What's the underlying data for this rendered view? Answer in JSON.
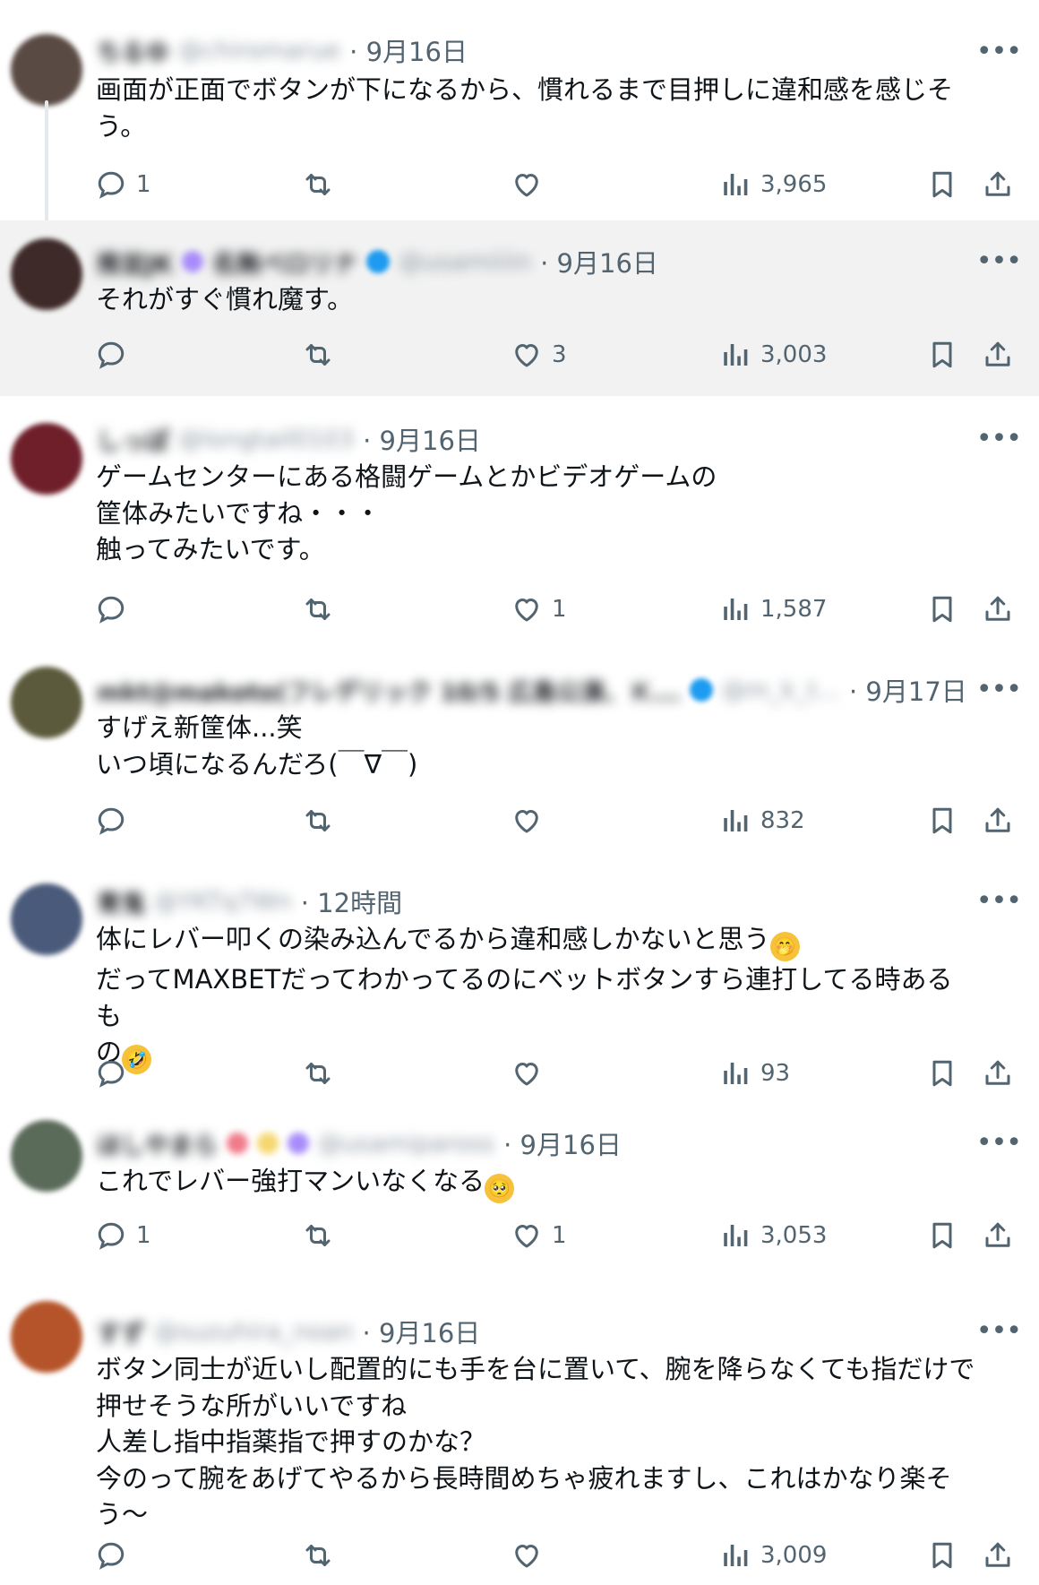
{
  "menu_glyph": "•••",
  "tweets": [
    {
      "id": "t1",
      "avatar_color": "#5a4a44",
      "name_blurred": "ちるゆ",
      "handle_blurred": "@chiromarue",
      "decor": [],
      "date_label": "· 9月16日",
      "text": "画面が正面でボタンが下になるから、慣れるまで目押しに違和感を感じそ\nう。",
      "emoji": null,
      "reply_count": "1",
      "like_count": "",
      "view_count": "3,965"
    },
    {
      "id": "t2",
      "avatar_color": "#3e2a28",
      "name_blurred": "推並JK",
      "handle_blurred": "@usamiiiin",
      "decor": [
        "#a78bfa",
        "名無べロリナ",
        "#1d9bf0"
      ],
      "date_label": "· 9月16日",
      "text": "それがすぐ慣れ魔す。",
      "emoji": null,
      "reply_count": "",
      "like_count": "3",
      "view_count": "3,003"
    },
    {
      "id": "t3",
      "avatar_color": "#6e1f2a",
      "name_blurred": "しっぽ",
      "handle_blurred": "@longtail0103",
      "decor": [],
      "date_label": "· 9月16日",
      "text": "ゲームセンターにある格闘ゲームとかビデオゲームの\n筐体みたいですね・・・\n触ってみたいです。",
      "emoji": null,
      "reply_count": "",
      "like_count": "1",
      "view_count": "1,587"
    },
    {
      "id": "t4",
      "avatar_color": "#5c5a3c",
      "name_blurred": "mkt@makoto(フレデリック 10/5 広島公演、Ｋ...",
      "handle_blurred": "@m_k_t...",
      "decor": [],
      "date_label": "· 9月17日",
      "text": "すげえ新筐体...笑\nいつ頃になるんだろ(￣∇￣)",
      "emoji": null,
      "reply_count": "",
      "like_count": "",
      "view_count": "832"
    },
    {
      "id": "t5",
      "avatar_color": "#4a5a7a",
      "name_blurred": "青鬼",
      "handle_blurred": "@YKTq7Wn",
      "decor": [],
      "date_label": "· 12時間",
      "text": "体にレバー叩くの染み込んでるから違和感しかないと思う",
      "text_emoji": "🤭",
      "text2": "\nだってMAXBETだってわかってるのにベットボタンすら連打してる時あるも\nの",
      "emoji": "🤣",
      "reply_count": "",
      "like_count": "",
      "view_count": "93"
    },
    {
      "id": "t6",
      "avatar_color": "#5b6b5a",
      "name_blurred": "ほしやまら",
      "handle_blurred": "@usamipaross",
      "decor": [
        "#f07a8a",
        "#f5d76e",
        "#a78bfa"
      ],
      "date_label": "· 9月16日",
      "text": "これでレバー強打マンいなくなる",
      "emoji": "🥺",
      "reply_count": "1",
      "like_count": "1",
      "view_count": "3,053"
    },
    {
      "id": "t7",
      "avatar_color": "#b5542a",
      "name_blurred": "すず",
      "handle_blurred": "@suzuhira_noan",
      "decor": [],
      "date_label": "· 9月16日",
      "text": "ボタン同士が近いし配置的にも手を台に置いて、腕を降らなくても指だけで\n押せそうな所がいいですね\n人差し指中指薬指で押すのかな？\n今のって腕をあげてやるから長時間めちゃ疲れますし、これはかなり楽そ\nう〜",
      "emoji": null,
      "reply_count": "",
      "like_count": "",
      "view_count": "3,009"
    }
  ]
}
